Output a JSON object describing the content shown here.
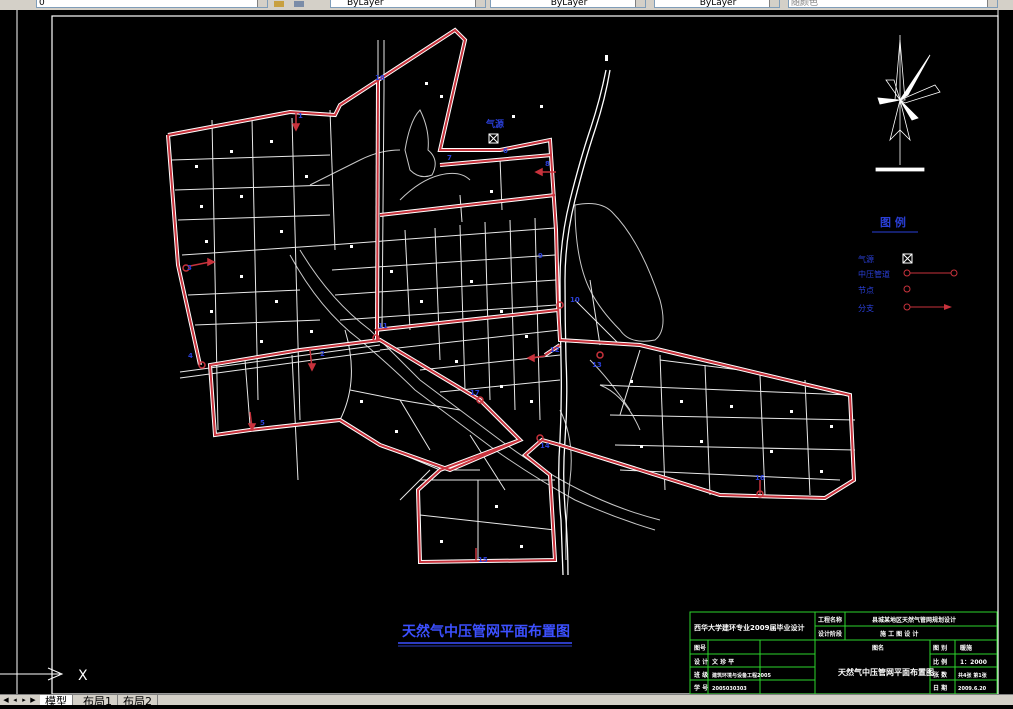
{
  "toolbar": {
    "layer_value": "0",
    "color_value": "ByLayer",
    "linetype_value": "ByLayer",
    "lineweight_value": "ByLayer",
    "plotstyle_value": "随颜色"
  },
  "drawing": {
    "title": "天然气中压管网平面布置图",
    "gas_source_label": "气源",
    "legend": {
      "title": "图  例",
      "items": [
        "气源",
        "中压管道",
        "节点",
        "分支"
      ]
    },
    "node_labels": [
      "1",
      "2",
      "3",
      "4",
      "5",
      "6",
      "7",
      "8",
      "9",
      "10",
      "11",
      "12",
      "13",
      "14",
      "15",
      "16",
      "17",
      "18"
    ],
    "ucs_x_label": "X"
  },
  "title_block": {
    "university": "西华大学建环专业2009届毕业设计",
    "project_name_label": "工程名称",
    "project_name": "县城某地区天然气管网规划设计",
    "design_stage_label": "设计阶段",
    "design_stage": "施 工 图 设 计",
    "drawing_name": "天然气中压管网平面布置图",
    "rows": [
      {
        "label": "图号",
        "value": ""
      },
      {
        "label": "设  计",
        "value": "文 珍 平"
      },
      {
        "label": "班  级",
        "value": "建筑环境与设备工程2005"
      },
      {
        "label": "学  号",
        "value": "2005030303"
      }
    ],
    "right_rows": [
      {
        "label": "图  别",
        "value": "暖施"
      },
      {
        "label": "比  例",
        "value": "1：2000"
      },
      {
        "label": "张  数",
        "value": "共4张 第1张"
      },
      {
        "label": "日  期",
        "value": "2009.6.20"
      }
    ],
    "count_label": "图名"
  },
  "status": {
    "tabs": [
      "模型",
      "布局1",
      "布局2"
    ],
    "active_tab": "模型"
  },
  "colors": {
    "pipe": "#c8323c",
    "road": "#ffffff",
    "label_blue": "#2a3fd8",
    "title_blue": "#3c50ff",
    "title_block": "#2bd42b",
    "title_block_text": "#ffffff"
  }
}
